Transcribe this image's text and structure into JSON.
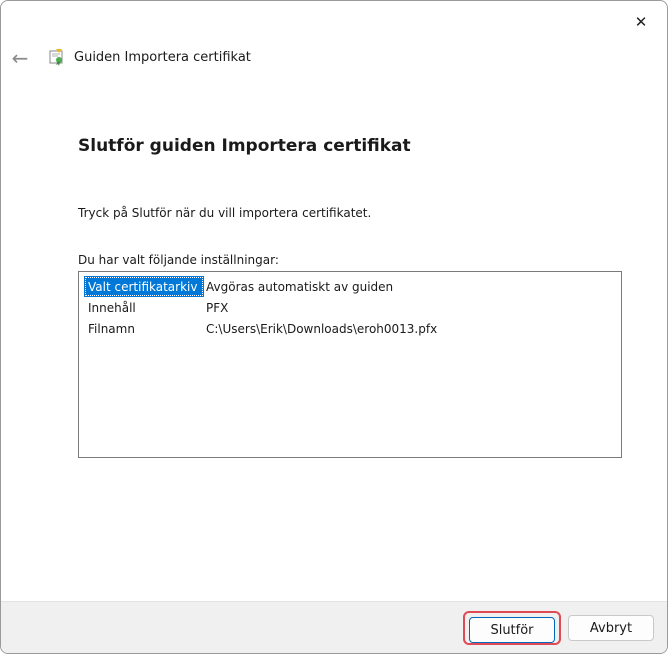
{
  "window": {
    "close_glyph": "✕",
    "back_glyph": "←",
    "title": "Guiden Importera certifikat"
  },
  "page": {
    "heading": "Slutför guiden Importera certifikat",
    "instruction": "Tryck på Slutför när du vill importera certifikatet.",
    "settings_label": "Du har valt följande inställningar:"
  },
  "settings": {
    "rows": [
      {
        "key": "Valt certifikatarkiv",
        "value": "Avgöras automatiskt av guiden",
        "selected": true
      },
      {
        "key": "Innehåll",
        "value": "PFX",
        "selected": false
      },
      {
        "key": "Filnamn",
        "value": "C:\\Users\\Erik\\Downloads\\eroh0013.pfx",
        "selected": false
      }
    ]
  },
  "footer": {
    "finish_label": "Slutför",
    "cancel_label": "Avbryt"
  },
  "colors": {
    "selection": "#0078d7",
    "highlight_border": "#e04a55",
    "footer_bg": "#f0f0f0"
  },
  "icons": {
    "back": "arrow-left-icon",
    "close": "close-icon",
    "header": "certificate-icon"
  }
}
